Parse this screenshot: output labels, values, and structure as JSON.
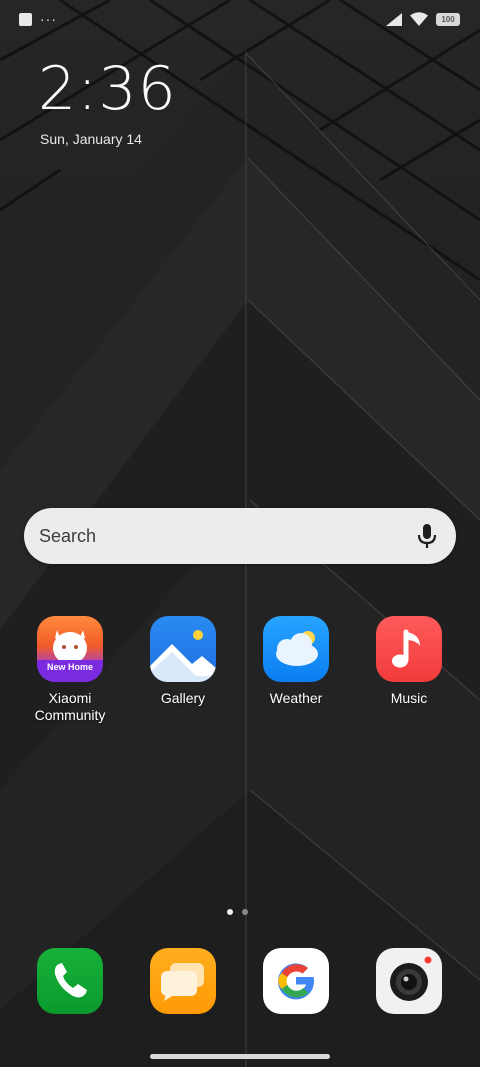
{
  "status_bar": {
    "more_indicator": "···",
    "battery_level": "100"
  },
  "lock_clock": {
    "time": "2:36",
    "date": "Sun, January 14"
  },
  "search": {
    "placeholder": "Search"
  },
  "home_apps": [
    {
      "label": "Xiaomi Community",
      "icon": "xiaomi-community-icon",
      "badge_text": "New Home"
    },
    {
      "label": "Gallery",
      "icon": "gallery-icon"
    },
    {
      "label": "Weather",
      "icon": "weather-icon"
    },
    {
      "label": "Music",
      "icon": "music-icon"
    }
  ],
  "dock_apps": [
    {
      "icon": "phone-icon"
    },
    {
      "icon": "messaging-icon"
    },
    {
      "icon": "google-icon"
    },
    {
      "icon": "camera-icon"
    }
  ],
  "pager": {
    "pages": 2,
    "current": 1
  },
  "colors": {
    "community_orange": "#f25c2a",
    "community_purple": "#7a2be0",
    "gallery_blue": "#1f6fe0",
    "weather_blue": "#0b7ef2",
    "music_red": "#f23b3b",
    "phone_green": "#0a9a2c",
    "messaging_orange": "#ff9a05",
    "google_red": "#ea4335",
    "google_yellow": "#fbbc05",
    "google_green": "#34a853",
    "google_blue": "#4285f4"
  }
}
